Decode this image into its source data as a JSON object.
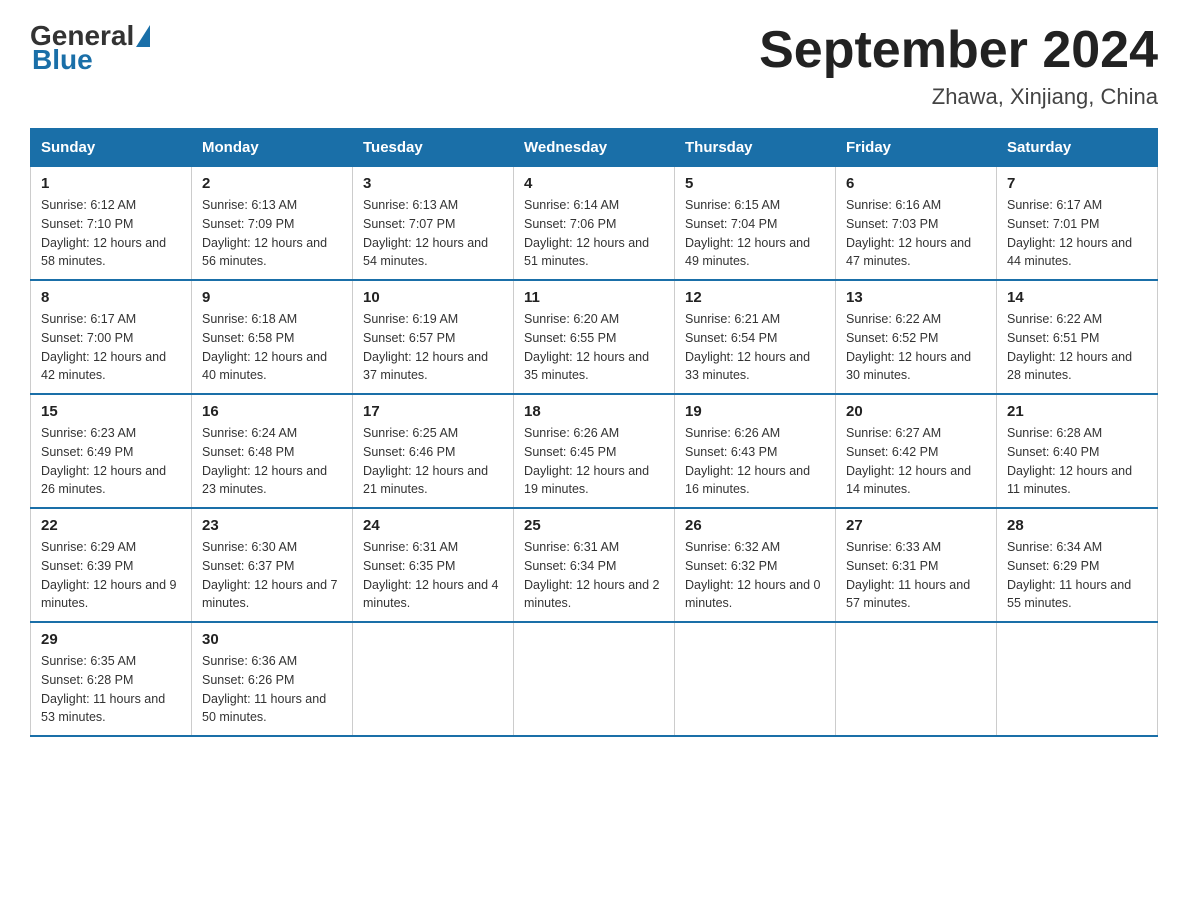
{
  "logo": {
    "general": "General",
    "blue": "Blue"
  },
  "title": "September 2024",
  "subtitle": "Zhawa, Xinjiang, China",
  "days_header": [
    "Sunday",
    "Monday",
    "Tuesday",
    "Wednesday",
    "Thursday",
    "Friday",
    "Saturday"
  ],
  "weeks": [
    [
      {
        "day": "1",
        "sunrise": "Sunrise: 6:12 AM",
        "sunset": "Sunset: 7:10 PM",
        "daylight": "Daylight: 12 hours and 58 minutes."
      },
      {
        "day": "2",
        "sunrise": "Sunrise: 6:13 AM",
        "sunset": "Sunset: 7:09 PM",
        "daylight": "Daylight: 12 hours and 56 minutes."
      },
      {
        "day": "3",
        "sunrise": "Sunrise: 6:13 AM",
        "sunset": "Sunset: 7:07 PM",
        "daylight": "Daylight: 12 hours and 54 minutes."
      },
      {
        "day": "4",
        "sunrise": "Sunrise: 6:14 AM",
        "sunset": "Sunset: 7:06 PM",
        "daylight": "Daylight: 12 hours and 51 minutes."
      },
      {
        "day": "5",
        "sunrise": "Sunrise: 6:15 AM",
        "sunset": "Sunset: 7:04 PM",
        "daylight": "Daylight: 12 hours and 49 minutes."
      },
      {
        "day": "6",
        "sunrise": "Sunrise: 6:16 AM",
        "sunset": "Sunset: 7:03 PM",
        "daylight": "Daylight: 12 hours and 47 minutes."
      },
      {
        "day": "7",
        "sunrise": "Sunrise: 6:17 AM",
        "sunset": "Sunset: 7:01 PM",
        "daylight": "Daylight: 12 hours and 44 minutes."
      }
    ],
    [
      {
        "day": "8",
        "sunrise": "Sunrise: 6:17 AM",
        "sunset": "Sunset: 7:00 PM",
        "daylight": "Daylight: 12 hours and 42 minutes."
      },
      {
        "day": "9",
        "sunrise": "Sunrise: 6:18 AM",
        "sunset": "Sunset: 6:58 PM",
        "daylight": "Daylight: 12 hours and 40 minutes."
      },
      {
        "day": "10",
        "sunrise": "Sunrise: 6:19 AM",
        "sunset": "Sunset: 6:57 PM",
        "daylight": "Daylight: 12 hours and 37 minutes."
      },
      {
        "day": "11",
        "sunrise": "Sunrise: 6:20 AM",
        "sunset": "Sunset: 6:55 PM",
        "daylight": "Daylight: 12 hours and 35 minutes."
      },
      {
        "day": "12",
        "sunrise": "Sunrise: 6:21 AM",
        "sunset": "Sunset: 6:54 PM",
        "daylight": "Daylight: 12 hours and 33 minutes."
      },
      {
        "day": "13",
        "sunrise": "Sunrise: 6:22 AM",
        "sunset": "Sunset: 6:52 PM",
        "daylight": "Daylight: 12 hours and 30 minutes."
      },
      {
        "day": "14",
        "sunrise": "Sunrise: 6:22 AM",
        "sunset": "Sunset: 6:51 PM",
        "daylight": "Daylight: 12 hours and 28 minutes."
      }
    ],
    [
      {
        "day": "15",
        "sunrise": "Sunrise: 6:23 AM",
        "sunset": "Sunset: 6:49 PM",
        "daylight": "Daylight: 12 hours and 26 minutes."
      },
      {
        "day": "16",
        "sunrise": "Sunrise: 6:24 AM",
        "sunset": "Sunset: 6:48 PM",
        "daylight": "Daylight: 12 hours and 23 minutes."
      },
      {
        "day": "17",
        "sunrise": "Sunrise: 6:25 AM",
        "sunset": "Sunset: 6:46 PM",
        "daylight": "Daylight: 12 hours and 21 minutes."
      },
      {
        "day": "18",
        "sunrise": "Sunrise: 6:26 AM",
        "sunset": "Sunset: 6:45 PM",
        "daylight": "Daylight: 12 hours and 19 minutes."
      },
      {
        "day": "19",
        "sunrise": "Sunrise: 6:26 AM",
        "sunset": "Sunset: 6:43 PM",
        "daylight": "Daylight: 12 hours and 16 minutes."
      },
      {
        "day": "20",
        "sunrise": "Sunrise: 6:27 AM",
        "sunset": "Sunset: 6:42 PM",
        "daylight": "Daylight: 12 hours and 14 minutes."
      },
      {
        "day": "21",
        "sunrise": "Sunrise: 6:28 AM",
        "sunset": "Sunset: 6:40 PM",
        "daylight": "Daylight: 12 hours and 11 minutes."
      }
    ],
    [
      {
        "day": "22",
        "sunrise": "Sunrise: 6:29 AM",
        "sunset": "Sunset: 6:39 PM",
        "daylight": "Daylight: 12 hours and 9 minutes."
      },
      {
        "day": "23",
        "sunrise": "Sunrise: 6:30 AM",
        "sunset": "Sunset: 6:37 PM",
        "daylight": "Daylight: 12 hours and 7 minutes."
      },
      {
        "day": "24",
        "sunrise": "Sunrise: 6:31 AM",
        "sunset": "Sunset: 6:35 PM",
        "daylight": "Daylight: 12 hours and 4 minutes."
      },
      {
        "day": "25",
        "sunrise": "Sunrise: 6:31 AM",
        "sunset": "Sunset: 6:34 PM",
        "daylight": "Daylight: 12 hours and 2 minutes."
      },
      {
        "day": "26",
        "sunrise": "Sunrise: 6:32 AM",
        "sunset": "Sunset: 6:32 PM",
        "daylight": "Daylight: 12 hours and 0 minutes."
      },
      {
        "day": "27",
        "sunrise": "Sunrise: 6:33 AM",
        "sunset": "Sunset: 6:31 PM",
        "daylight": "Daylight: 11 hours and 57 minutes."
      },
      {
        "day": "28",
        "sunrise": "Sunrise: 6:34 AM",
        "sunset": "Sunset: 6:29 PM",
        "daylight": "Daylight: 11 hours and 55 minutes."
      }
    ],
    [
      {
        "day": "29",
        "sunrise": "Sunrise: 6:35 AM",
        "sunset": "Sunset: 6:28 PM",
        "daylight": "Daylight: 11 hours and 53 minutes."
      },
      {
        "day": "30",
        "sunrise": "Sunrise: 6:36 AM",
        "sunset": "Sunset: 6:26 PM",
        "daylight": "Daylight: 11 hours and 50 minutes."
      },
      null,
      null,
      null,
      null,
      null
    ]
  ]
}
